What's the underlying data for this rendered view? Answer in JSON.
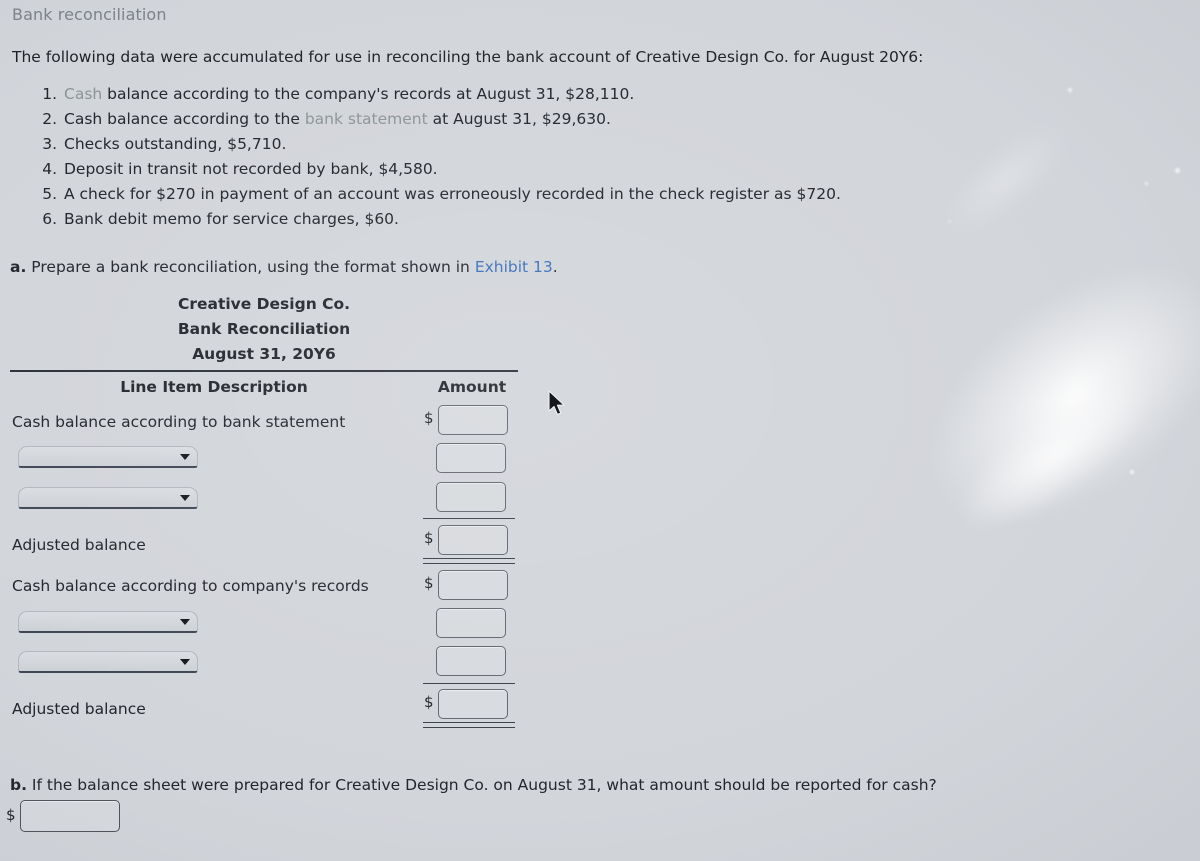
{
  "question": {
    "title": "Bank reconciliation",
    "intro": "The following data were accumulated for use in reconciling the bank account of Creative Design Co. for August 20Y6:",
    "items": [
      {
        "num": "1.",
        "link_text": "Cash",
        "link_style": "visited",
        "rest": " balance according to the company's records at August 31, $28,110."
      },
      {
        "num": "2.",
        "pre": "Cash balance according to the ",
        "link_text": "bank statement",
        "link_style": "visited",
        "rest": " at August 31, $29,630."
      },
      {
        "num": "3.",
        "plain": "Checks outstanding, $5,710."
      },
      {
        "num": "4.",
        "plain": "Deposit in transit not recorded by bank, $4,580."
      },
      {
        "num": "5.",
        "plain": "A check for $270 in payment of an account was erroneously recorded in the check register as $720."
      },
      {
        "num": "6.",
        "plain": "Bank debit memo for service charges, $60."
      }
    ]
  },
  "part_a": {
    "label": "a.",
    "text_before": "Prepare a bank reconciliation, using the format shown in ",
    "link_text": "Exhibit 13",
    "text_after": "."
  },
  "statement": {
    "company": "Creative Design Co.",
    "title": "Bank Reconciliation",
    "date": "August 31, 20Y6",
    "columns": {
      "description": "Line Item Description",
      "amount": "Amount"
    },
    "rows": [
      {
        "type": "label",
        "label": "Cash balance according to bank statement",
        "dollar": "$",
        "input_value": ""
      },
      {
        "type": "dropdown",
        "selected": "",
        "dollar": "",
        "input_value": ""
      },
      {
        "type": "dropdown",
        "selected": "",
        "dollar": "",
        "input_value": ""
      },
      {
        "type": "label",
        "label": "Adjusted balance",
        "dollar": "$",
        "input_value": ""
      },
      {
        "type": "label",
        "label": "Cash balance according to company's records",
        "dollar": "$",
        "input_value": ""
      },
      {
        "type": "dropdown",
        "selected": "",
        "dollar": "",
        "input_value": ""
      },
      {
        "type": "dropdown",
        "selected": "",
        "dollar": "",
        "input_value": ""
      },
      {
        "type": "label",
        "label": "Adjusted balance",
        "dollar": "$",
        "input_value": ""
      }
    ],
    "input_placeholder": ""
  },
  "part_b": {
    "label": "b.",
    "text": "If the balance sheet were prepared for Creative Design Co. on August 31, what amount should be reported for cash?",
    "dollar": "$",
    "input_value": "",
    "input_placeholder": ""
  },
  "cut_off_text": "",
  "colors": {
    "background": "#d2d5da",
    "text": "#22252b",
    "title_gray": "#7d8289",
    "link": "#3b6fb8",
    "link_visited": "#8c9397",
    "rule": "#2b2f36",
    "input_border": "#61666f",
    "input_fill": "#d7dade"
  }
}
